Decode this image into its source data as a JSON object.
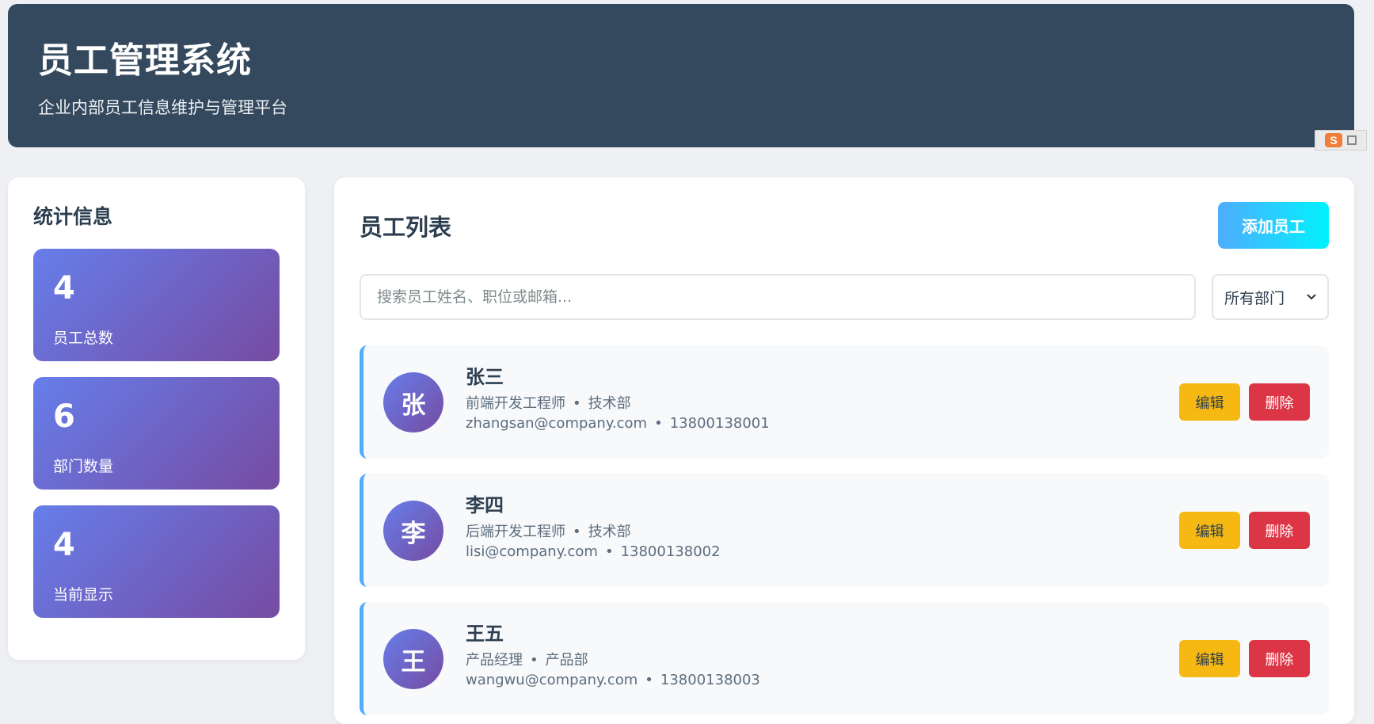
{
  "header": {
    "title": "员工管理系统",
    "subtitle": "企业内部员工信息维护与管理平台"
  },
  "ime": {
    "label": "S"
  },
  "sidebar": {
    "title": "统计信息",
    "stats": [
      {
        "value": "4",
        "label": "员工总数"
      },
      {
        "value": "6",
        "label": "部门数量"
      },
      {
        "value": "4",
        "label": "当前显示"
      }
    ]
  },
  "main": {
    "title": "员工列表",
    "add_button": "添加员工",
    "search_placeholder": "搜索员工姓名、职位或邮箱...",
    "department_filter": "所有部门"
  },
  "employees": [
    {
      "avatar": "张",
      "name": "张三",
      "position": "前端开发工程师",
      "department": "技术部",
      "email": "zhangsan@company.com",
      "phone": "13800138001",
      "edit_label": "编辑",
      "delete_label": "删除"
    },
    {
      "avatar": "李",
      "name": "李四",
      "position": "后端开发工程师",
      "department": "技术部",
      "email": "lisi@company.com",
      "phone": "13800138002",
      "edit_label": "编辑",
      "delete_label": "删除"
    },
    {
      "avatar": "王",
      "name": "王五",
      "position": "产品经理",
      "department": "产品部",
      "email": "wangwu@company.com",
      "phone": "13800138003",
      "edit_label": "编辑",
      "delete_label": "删除"
    }
  ],
  "separator": "•",
  "colors": {
    "header_bg": "#34495e",
    "accent_gradient_start": "#667eea",
    "accent_gradient_end": "#764ba2",
    "add_button_start": "#4facfe",
    "add_button_end": "#00f2fe",
    "edit_button": "#f6b913",
    "delete_button": "#dc3545"
  }
}
